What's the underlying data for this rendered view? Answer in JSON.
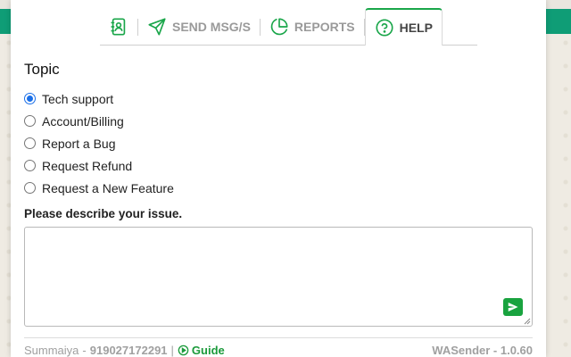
{
  "tabs": [
    {
      "label": "",
      "icon": "contacts-icon",
      "active": false
    },
    {
      "label": "SEND MSG/S",
      "icon": "send-icon",
      "active": false
    },
    {
      "label": "REPORTS",
      "icon": "pie-chart-icon",
      "active": false
    },
    {
      "label": "HELP",
      "icon": "help-circle-icon",
      "active": true
    }
  ],
  "help": {
    "topic_title": "Topic",
    "options": [
      {
        "label": "Tech support",
        "checked": true
      },
      {
        "label": "Account/Billing",
        "checked": false
      },
      {
        "label": "Report a Bug",
        "checked": false
      },
      {
        "label": "Request Refund",
        "checked": false
      },
      {
        "label": "Request a New Feature",
        "checked": false
      }
    ],
    "describe_label": "Please describe your issue.",
    "issue_text": "",
    "send_icon": "send-icon"
  },
  "footer": {
    "user_name": "Summaiya",
    "separator": "-",
    "phone": "919027172291",
    "pipe": "|",
    "guide_label": "Guide",
    "version": "WASender - 1.0.60"
  },
  "colors": {
    "accent": "#19a33f",
    "header_green": "#0f9d76",
    "radio_checked": "#1a6fe8"
  }
}
